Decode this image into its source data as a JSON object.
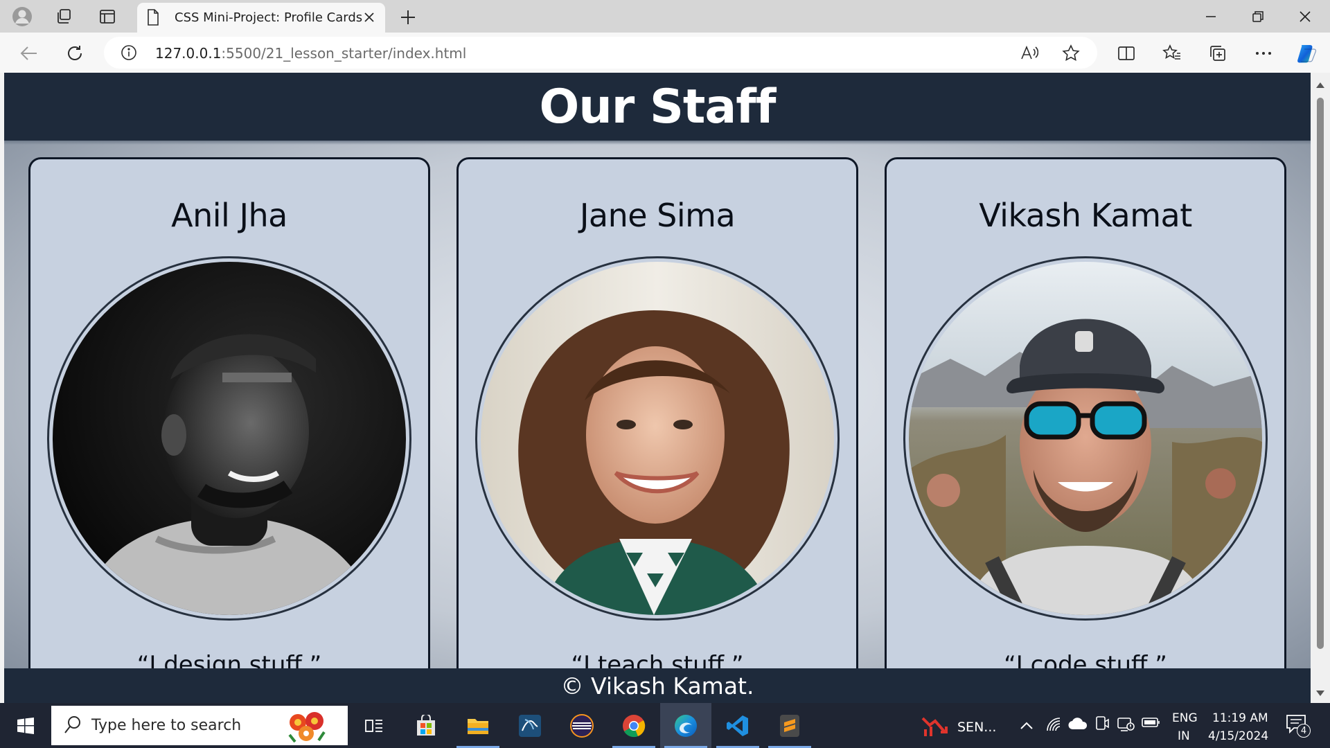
{
  "browser": {
    "tab_title": "CSS Mini-Project: Profile Cards",
    "url_host": "127.0.0.1",
    "url_path": ":5500/21_lesson_starter/index.html"
  },
  "page": {
    "title": "Our Staff",
    "cards": [
      {
        "name": "Anil Jha",
        "quote": "“I design stuff.”"
      },
      {
        "name": "Jane Sima",
        "quote": "“I teach stuff.”"
      },
      {
        "name": "Vikash Kamat",
        "quote": "“I code stuff.”"
      }
    ],
    "footer": "© Vikash Kamat."
  },
  "taskbar": {
    "search_placeholder": "Type here to search",
    "pinned_app_label": "SEN...",
    "lang_top": "ENG",
    "lang_bottom": "IN",
    "time": "11:19 AM",
    "date": "4/15/2024",
    "notification_count": "4"
  },
  "colors": {
    "header_bg": "#1e2a3b",
    "card_bg": "#c7d1e0",
    "taskbar_bg": "#1f2533",
    "accent": "#0078d4"
  }
}
